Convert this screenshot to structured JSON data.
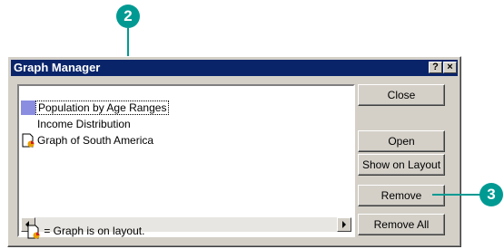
{
  "callouts": {
    "step_a": "2",
    "step_b": "3"
  },
  "window": {
    "title": "Graph Manager",
    "help_label": "?",
    "close_label": "×"
  },
  "list": {
    "items": [
      {
        "label": "Population by Age Ranges",
        "icon": "graph-swatch-icon",
        "selected": true
      },
      {
        "label": "Income Distribution",
        "icon": "",
        "selected": false
      },
      {
        "label": "Graph of South America",
        "icon": "graph-on-layout-icon",
        "selected": false
      }
    ]
  },
  "buttons": {
    "close": "Close",
    "open": "Open",
    "show_on_layout": "Show on Layout",
    "remove": "Remove",
    "remove_all": "Remove All"
  },
  "legend": {
    "text": "= Graph is on layout."
  },
  "colors": {
    "callout": "#009a93",
    "titlebar": "#0a246a",
    "face": "#d4d0c8"
  }
}
